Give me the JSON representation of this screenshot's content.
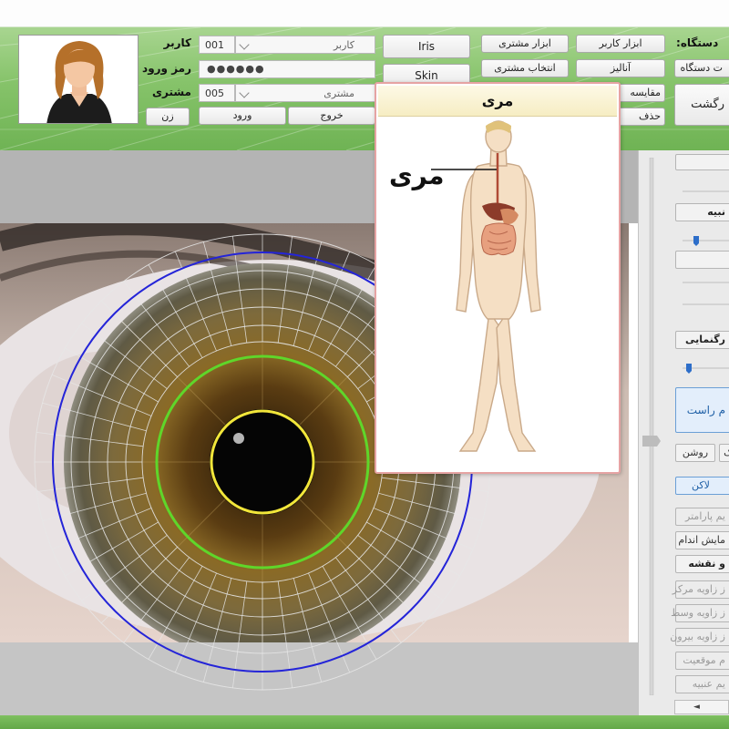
{
  "header": {
    "user_label": "کاربر",
    "user_code": "001",
    "user_select": "کاربر",
    "password_label": "رمز ورود",
    "password_value": "●●●●●●",
    "customer_label": "مشتری",
    "customer_code": "005",
    "customer_select": "مشتری",
    "gender_button": "زن",
    "login_button": "ورود",
    "exit_button": "خروج",
    "iris_button": "Iris",
    "skin_button": "Skin",
    "customer_tools_button": "ابزار مشتری",
    "select_customer_button": "انتخاب مشتری",
    "user_tools_button": "ابزار کاربر",
    "analyze_button": "آنالیز",
    "compare_button": "مقایسه",
    "delete_button": "حذف",
    "device_label": ":دستگاه",
    "device_button": "ت دستگاه",
    "back_button": "رگشت"
  },
  "popup": {
    "title": "مری",
    "organ_label": "مری"
  },
  "right_panel": {
    "btn_iris_side": "نبیه",
    "btn_color": "رگنمایی",
    "btn_right_eye": "م راست",
    "btn_light": "روشن",
    "btn_k": "ک",
    "btn_spot": "لاکن",
    "btn_param": "یم پارامتر",
    "btn_show_organ": "مایش اندام",
    "btn_map": "و نقشه",
    "btn_center_angle": "ز زاویه مرکز",
    "btn_mid_angle": "ز زاویه وسط",
    "btn_out_angle": "ز زاویه بیرون",
    "btn_position": "م موقعیت",
    "btn_iris_set": "یم عنبیه",
    "scroll_left": "◄"
  },
  "colors": {
    "header_green": "#86c36a",
    "outer_circle": "#2424d8",
    "collarette_circle": "#5fd62a",
    "pupil_circle": "#f2e63a",
    "popup_border": "#e6a3a3"
  }
}
